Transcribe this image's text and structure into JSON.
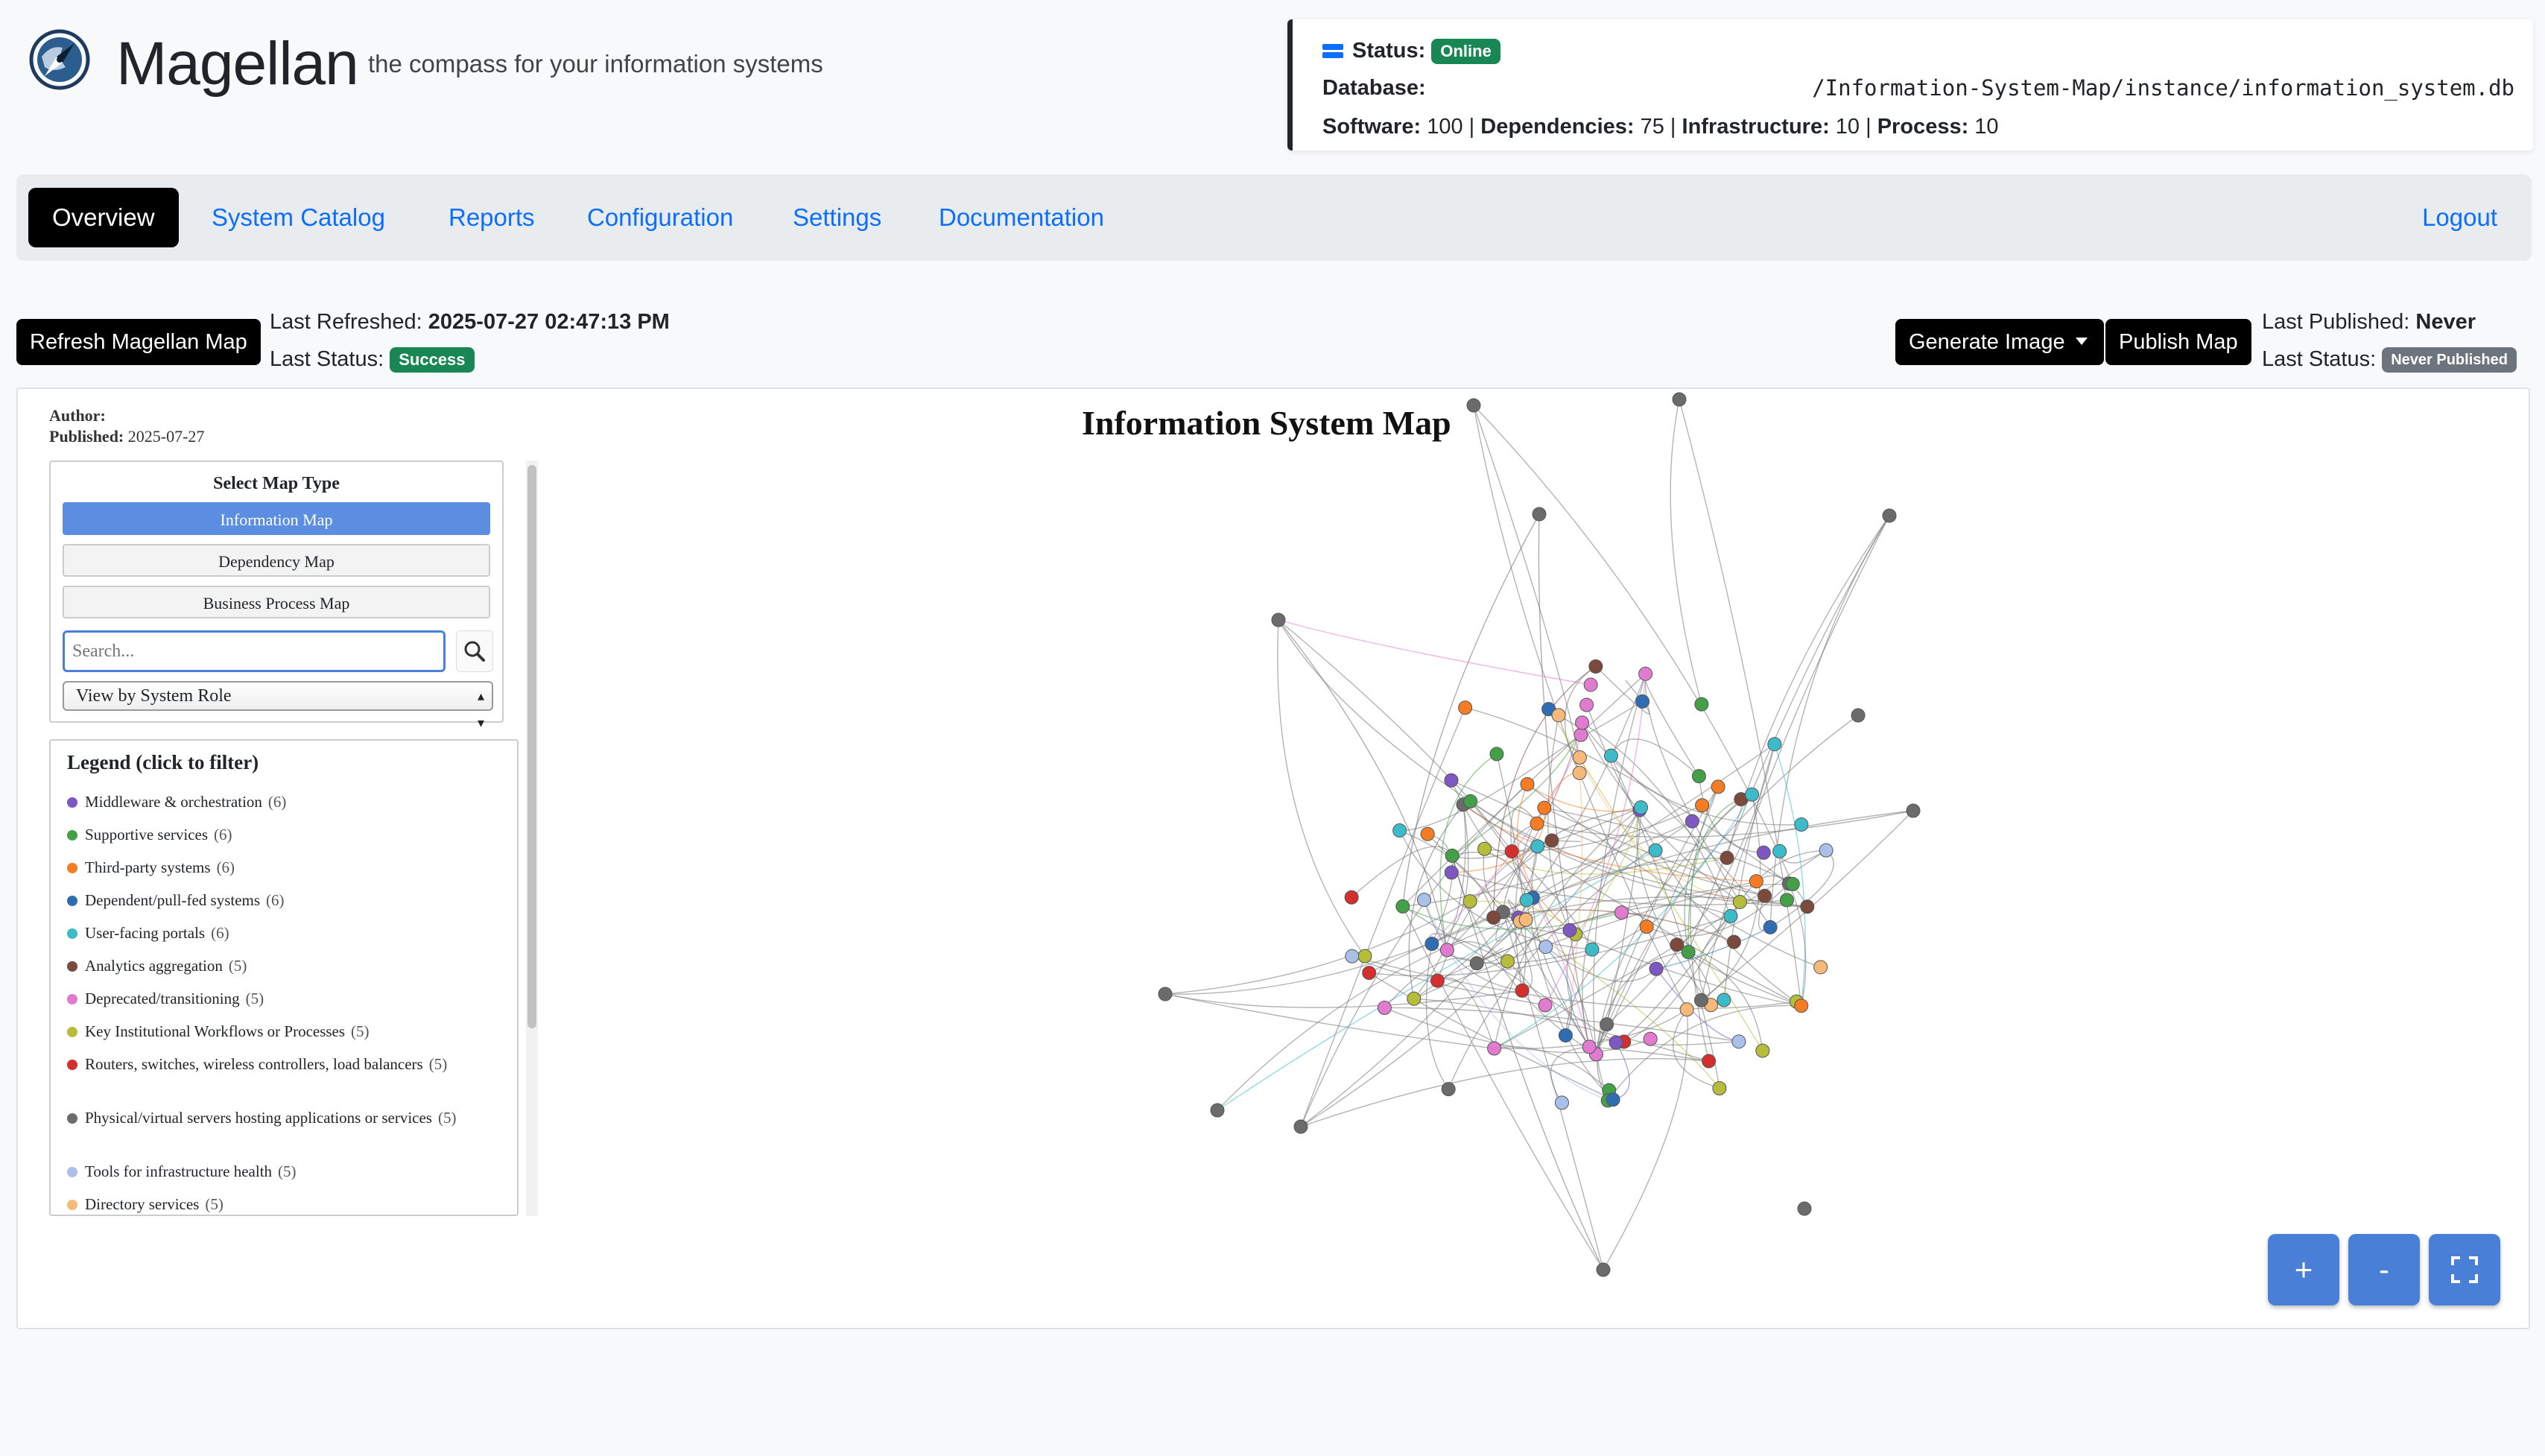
{
  "header": {
    "brand": "Magellan",
    "tagline": "the compass for your information systems"
  },
  "status_card": {
    "status_label": "Status:",
    "status_value": "Online",
    "database_label": "Database:",
    "database_path": "/Information-System-Map/instance/information_system.db",
    "software_label": "Software:",
    "software_count": "100",
    "dependencies_label": "Dependencies:",
    "dependencies_count": "75",
    "infrastructure_label": "Infrastructure:",
    "infrastructure_count": "10",
    "process_label": "Process:",
    "process_count": "10",
    "separator": " | "
  },
  "nav": {
    "items": [
      {
        "label": "Overview"
      },
      {
        "label": "System Catalog"
      },
      {
        "label": "Reports"
      },
      {
        "label": "Configuration"
      },
      {
        "label": "Settings"
      },
      {
        "label": "Documentation"
      }
    ],
    "logout": "Logout"
  },
  "actions": {
    "refresh_button": "Refresh Magellan Map",
    "last_refreshed_label": "Last Refreshed:",
    "last_refreshed_value": "2025-07-27 02:47:13 PM",
    "last_status_label": "Last Status:",
    "last_status_value": "Success",
    "generate_button": "Generate Image",
    "publish_button": "Publish Map",
    "last_published_label": "Last Published:",
    "last_published_value": "Never",
    "publish_status_label": "Last Status:",
    "publish_status_value": "Never Published"
  },
  "map": {
    "author_label": "Author:",
    "published_label": "Published:",
    "published_value": "2025-07-27",
    "title": "Information System Map",
    "map_type_heading": "Select Map Type",
    "map_types": [
      "Information Map",
      "Dependency Map",
      "Business Process Map"
    ],
    "search_placeholder": "Search...",
    "view_select_value": "View by System Role",
    "legend_title": "Legend (click to filter)",
    "legend": [
      {
        "label": "Middleware & orchestration",
        "count": "(6)",
        "color": "#7e57c2"
      },
      {
        "label": "Supportive services",
        "count": "(6)",
        "color": "#43a047"
      },
      {
        "label": "Third-party systems",
        "count": "(6)",
        "color": "#f57c22"
      },
      {
        "label": "Dependent/pull-fed systems",
        "count": "(6)",
        "color": "#2e6db4"
      },
      {
        "label": "User-facing portals",
        "count": "(6)",
        "color": "#3dbbc8"
      },
      {
        "label": "Analytics aggregation",
        "count": "(5)",
        "color": "#7b4a3c"
      },
      {
        "label": "Deprecated/transitioning",
        "count": "(5)",
        "color": "#e07bcf"
      },
      {
        "label": "Key Institutional Workflows or Processes",
        "count": "(5)",
        "color": "#b5bd3a"
      },
      {
        "label": "Routers, switches, wireless controllers, load balancers",
        "count": "(5)",
        "color": "#d32f2f"
      },
      {
        "label": "Physical/virtual servers hosting applications or services",
        "count": "(5)",
        "color": "#6b6b6b"
      },
      {
        "label": "Tools for infrastructure health",
        "count": "(5)",
        "color": "#a9c0ea"
      },
      {
        "label": "Directory services",
        "count": "(5)",
        "color": "#f5b97a"
      }
    ],
    "zoom_in": "+",
    "zoom_out": "-"
  },
  "colors": {
    "accent": "#0d6efd",
    "success": "#198754",
    "muted": "#6c757d",
    "map_button": "#4a7fd8"
  },
  "icons": {
    "logo": "compass-icon",
    "database": "database-icon",
    "search": "magnifier-icon",
    "fullscreen": "fullscreen-icon",
    "dropdown": "caret-down-icon"
  }
}
